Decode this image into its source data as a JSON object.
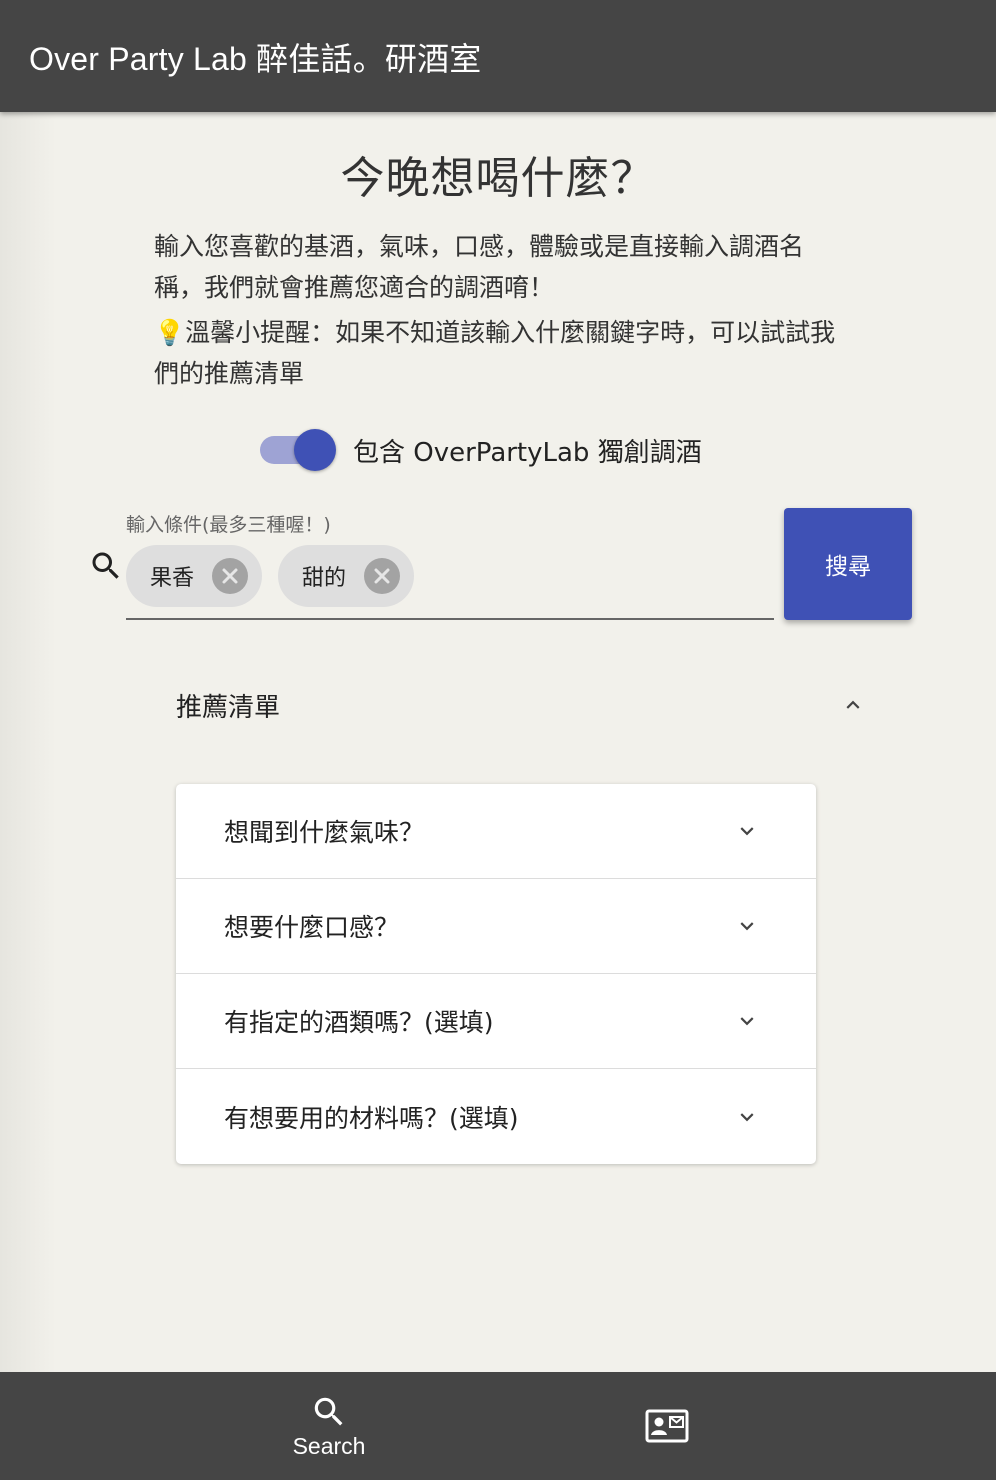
{
  "app_bar": {
    "title": "Over Party Lab 醉佳話。研酒室"
  },
  "main": {
    "heading": "今晚想喝什麼？",
    "description": "輸入您喜歡的基酒，氣味，口感，體驗或是直接輸入調酒名稱，我們就會推薦您適合的調酒唷！",
    "tip_icon": "💡",
    "tip": "溫馨小提醒：如果不知道該輸入什麼關鍵字時，可以試試我們的推薦清單",
    "toggle": {
      "label": "包含 OverPartyLab 獨創調酒",
      "checked": true,
      "color": "#3f51b5"
    },
    "search": {
      "field_label": "輸入條件(最多三種喔！)",
      "chips": [
        {
          "label": "果香"
        },
        {
          "label": "甜的"
        }
      ],
      "button_label": "搜尋",
      "button_color": "#3f51b5"
    },
    "recommendations": {
      "title": "推薦清單",
      "expanded": true,
      "items": [
        {
          "label": "想聞到什麼氣味？"
        },
        {
          "label": "想要什麼口感？"
        },
        {
          "label": "有指定的酒類嗎？(選填)"
        },
        {
          "label": "有想要用的材料嗎？(選填)"
        }
      ]
    }
  },
  "bottom_nav": {
    "items": [
      {
        "label": "Search",
        "icon": "search-icon"
      },
      {
        "label": "",
        "icon": "contact-card-icon"
      }
    ]
  }
}
